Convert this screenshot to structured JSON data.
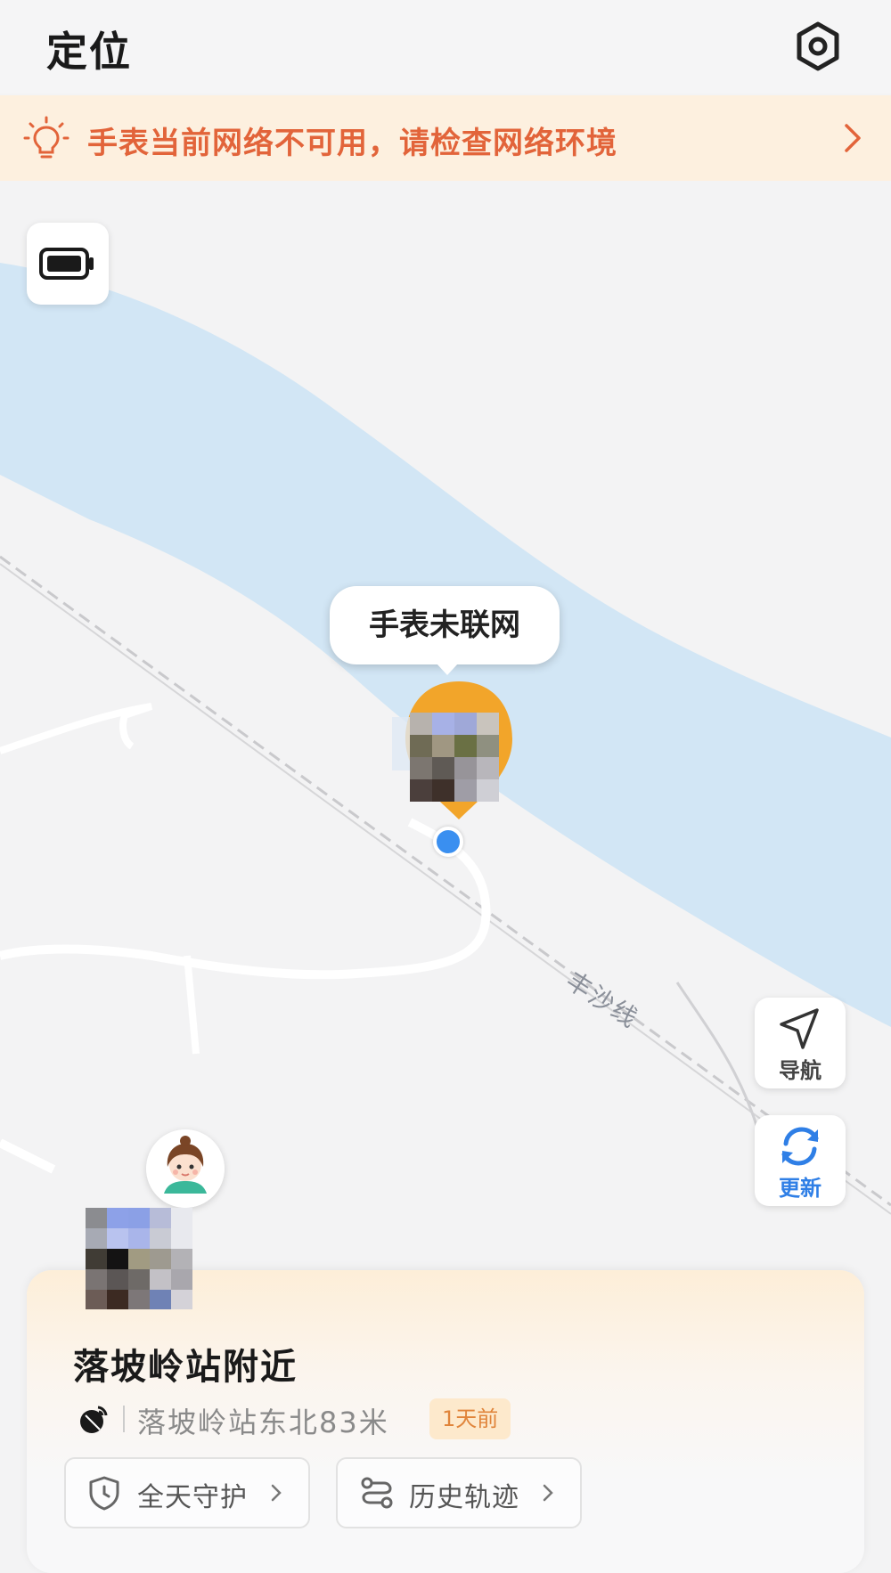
{
  "header": {
    "title": "定位"
  },
  "alert": {
    "text": "手表当前网络不可用，请检查网络环境"
  },
  "map": {
    "bubble_text": "手表未联网",
    "road_label": "丰沙线",
    "nav_label": "导航",
    "refresh_label": "更新",
    "river_color": "#d2e6f5",
    "land_color": "#f3f3f4"
  },
  "card": {
    "place": "落坡岭站附近",
    "address": "落坡岭站东北83米",
    "time_badge": "1天前",
    "guard_label": "全天守护",
    "history_label": "历史轨迹"
  },
  "icons": [
    "settings-icon",
    "lightbulb-icon",
    "chevron-right-icon",
    "battery-icon",
    "navigation-icon",
    "refresh-icon",
    "satellite-icon",
    "shield-icon",
    "route-icon"
  ]
}
